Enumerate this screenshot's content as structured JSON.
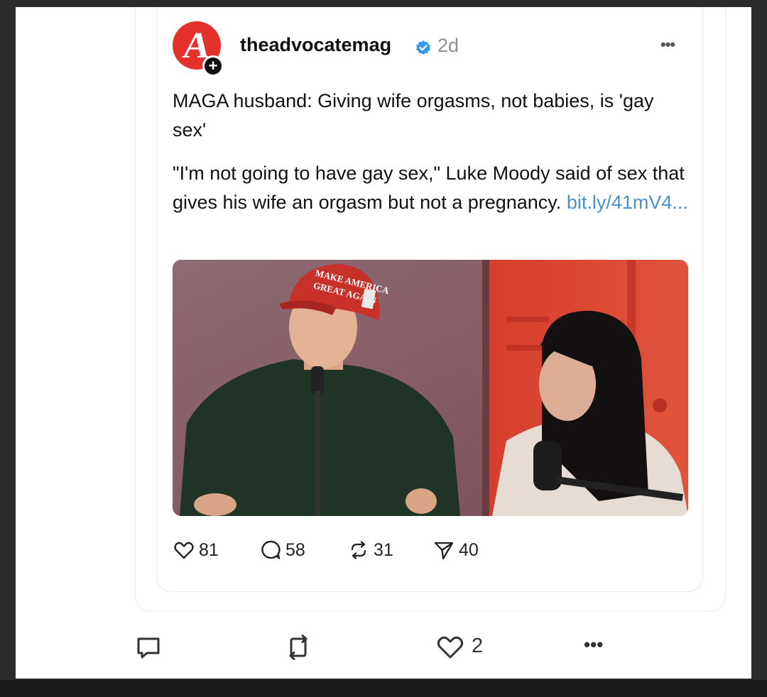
{
  "post": {
    "username": "theadvocatemag",
    "time": "2d",
    "more": "•••",
    "avatar_letter": "A",
    "follow_plus": "+",
    "headline": "MAGA husband: Giving wife orgasms, not babies, is 'gay sex'",
    "body": "\"I'm not going to have gay sex,\" Luke Moody said of sex that gives his wife an orgasm but not a pregnancy.",
    "link": "bit.ly/41mV4...",
    "image": {
      "hat_text_line1": "MAKE AMERICA",
      "hat_text_line2": "GREAT AGAIN"
    },
    "actions": {
      "likes": "81",
      "replies": "58",
      "reposts": "31",
      "shares": "40"
    }
  },
  "outer_actions": {
    "likes": "2",
    "more": "•••"
  },
  "colors": {
    "accent_red": "#e4312b",
    "link_blue": "#4c8fd0",
    "verified_blue": "#3897f0"
  },
  "icons": [
    "heart-icon",
    "comment-icon",
    "repost-icon",
    "share-icon",
    "verified-icon",
    "more-icon",
    "chat-bubble-icon",
    "retweet-icon"
  ]
}
